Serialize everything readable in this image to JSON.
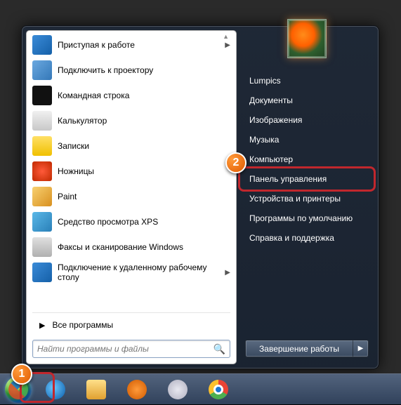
{
  "programs": [
    {
      "label": "Приступая к работе",
      "icon": "getting-started",
      "bg": "linear-gradient(135deg,#3a8bd8,#1560a8)",
      "submenu": true
    },
    {
      "label": "Подключить к проектору",
      "icon": "projector",
      "bg": "linear-gradient(135deg,#6aa8e0,#3478b8)"
    },
    {
      "label": "Командная строка",
      "icon": "cmd",
      "bg": "#111"
    },
    {
      "label": "Калькулятор",
      "icon": "calculator",
      "bg": "linear-gradient(#f0f0f0,#c8c8c8)"
    },
    {
      "label": "Записки",
      "icon": "sticky-notes",
      "bg": "linear-gradient(#ffe066,#f0c000)"
    },
    {
      "label": "Ножницы",
      "icon": "snip",
      "bg": "radial-gradient(circle,#ff5a3a,#c02a00)"
    },
    {
      "label": "Paint",
      "icon": "paint",
      "bg": "linear-gradient(135deg,#f8d070,#d89020)"
    },
    {
      "label": "Средство просмотра XPS",
      "icon": "xps",
      "bg": "linear-gradient(135deg,#5ab8e8,#2a80b8)"
    },
    {
      "label": "Факсы и сканирование Windows",
      "icon": "fax",
      "bg": "linear-gradient(#e0e0e0,#b0b0b0)"
    },
    {
      "label": "Подключение к удаленному рабочему столу",
      "icon": "rdp",
      "bg": "linear-gradient(135deg,#3a8bd8,#1560a8)",
      "submenu": true
    }
  ],
  "all_programs_label": "Все программы",
  "search": {
    "placeholder": "Найти программы и файлы"
  },
  "right_items": [
    "Lumpics",
    "Документы",
    "Изображения",
    "Музыка",
    "Компьютер",
    "Панель управления",
    "Устройства и принтеры",
    "Программы по умолчанию",
    "Справка и поддержка"
  ],
  "right_highlight_index": 5,
  "shutdown_label": "Завершение работы",
  "markers": {
    "start": "1",
    "control_panel": "2"
  },
  "colors": {
    "highlight": "#c1272d"
  }
}
